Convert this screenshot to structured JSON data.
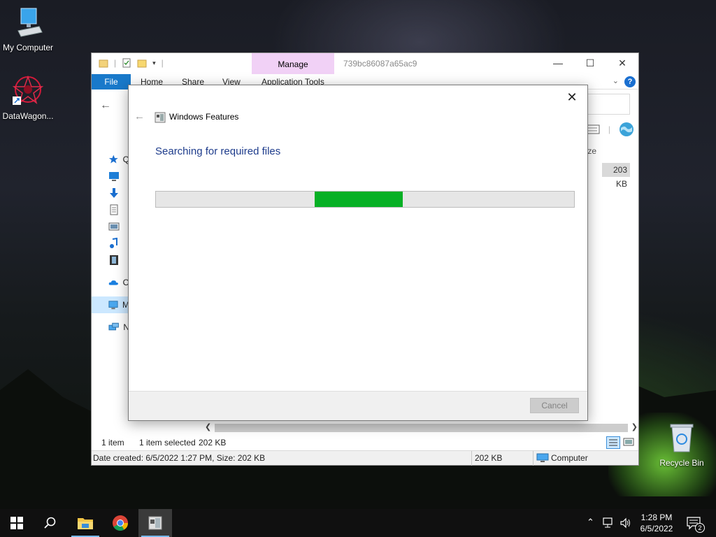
{
  "desktop": {
    "icons": [
      {
        "label": "My Computer"
      },
      {
        "label": "DataWagon..."
      },
      {
        "label": "Recycle Bin"
      }
    ]
  },
  "explorer": {
    "title": "739bc86087a65ac9",
    "context_tab": "Manage",
    "tabs": {
      "file": "File",
      "home": "Home",
      "share": "Share",
      "view": "View",
      "app_tools": "Application Tools"
    },
    "help": "?",
    "column_header": "ze",
    "file_size": "203 KB",
    "nav_items": [
      {
        "label": "Q",
        "icon": "star-icon"
      },
      {
        "label": "",
        "icon": "desktop-icon"
      },
      {
        "label": "",
        "icon": "downloads-icon"
      },
      {
        "label": "",
        "icon": "documents-icon"
      },
      {
        "label": "",
        "icon": "pictures-icon"
      },
      {
        "label": "",
        "icon": "music-icon"
      },
      {
        "label": "",
        "icon": "videos-icon"
      },
      {
        "label": "O",
        "icon": "onedrive-icon"
      },
      {
        "label": "M",
        "icon": "this-pc-icon"
      },
      {
        "label": "N",
        "icon": "network-icon"
      }
    ],
    "status": {
      "items": "1 item",
      "selected": "1 item selected",
      "selected_size": "202 KB"
    },
    "details": {
      "info": "Date created: 6/5/2022 1:27 PM, Size: 202 KB",
      "size": "202 KB",
      "location": "Computer"
    }
  },
  "dialog": {
    "title": "Windows Features",
    "heading": "Searching for required files",
    "progress_chunk_start": 0.38,
    "progress_chunk_end": 0.59,
    "progress_color": "#06b025",
    "cancel_label": "Cancel"
  },
  "taskbar": {
    "time": "1:28 PM",
    "date": "6/5/2022",
    "notifications": "2"
  }
}
